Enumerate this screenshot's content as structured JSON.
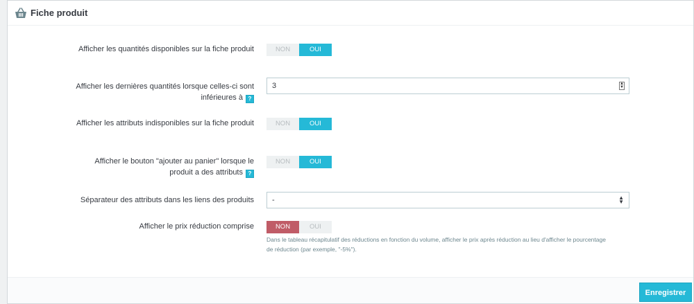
{
  "panel": {
    "title": "Fiche produit",
    "icon": "basket-icon"
  },
  "fields": [
    {
      "label": "Afficher les quantités disponibles sur la fiche produit",
      "type": "switch",
      "options": [
        "NON",
        "OUI"
      ],
      "selected": "OUI"
    },
    {
      "label": "Afficher les dernières quantités lorsque celles-ci sont inférieures à",
      "type": "number",
      "value": "3",
      "help_icon": "help-icon",
      "help_glyph": "?"
    },
    {
      "label": "Afficher les attributs indisponibles sur la fiche produit",
      "type": "switch",
      "options": [
        "NON",
        "OUI"
      ],
      "selected": "OUI"
    },
    {
      "label": "Afficher le bouton \"ajouter au panier\" lorsque le produit a des attributs",
      "type": "switch",
      "options": [
        "NON",
        "OUI"
      ],
      "selected": "OUI",
      "help_icon": "help-icon",
      "help_glyph": "?"
    },
    {
      "label": "Séparateur des attributs dans les liens des produits",
      "type": "select",
      "value": "-"
    },
    {
      "label": "Afficher le prix réduction comprise",
      "type": "switch",
      "options": [
        "NON",
        "OUI"
      ],
      "selected": "NON",
      "help_text": "Dans le tableau récapitulatif des réductions en fonction du volume, afficher le prix après réduction au lieu d'afficher le pourcentage de réduction (par exemple, \"-5%\")."
    }
  ],
  "footer": {
    "save_label": "Enregistrer"
  },
  "colors": {
    "accent": "#25b9d7",
    "danger": "#c05c67",
    "inactive_bg": "#eef1f2",
    "inactive_text": "#b7bcbf"
  }
}
